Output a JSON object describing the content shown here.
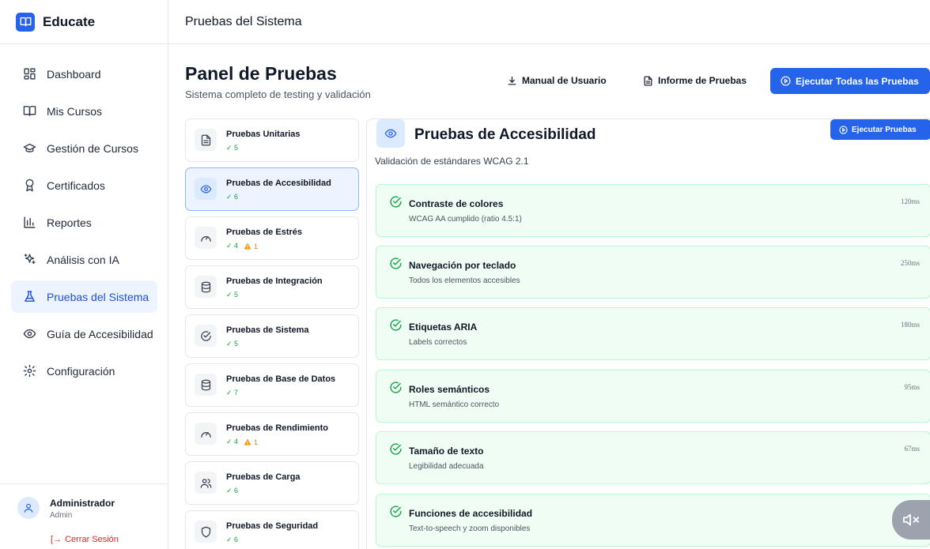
{
  "brand": {
    "name": "Educate"
  },
  "nav": {
    "items": [
      {
        "label": "Dashboard",
        "icon": "dashboard-icon"
      },
      {
        "label": "Mis Cursos",
        "icon": "book-open-icon"
      },
      {
        "label": "Gestión de Cursos",
        "icon": "graduation-cap-icon"
      },
      {
        "label": "Certificados",
        "icon": "award-icon"
      },
      {
        "label": "Reportes",
        "icon": "bar-chart-icon"
      },
      {
        "label": "Análisis con IA",
        "icon": "sparkles-icon"
      },
      {
        "label": "Pruebas del Sistema",
        "icon": "flask-icon",
        "active": true
      },
      {
        "label": "Guía de Accesibilidad",
        "icon": "eye-icon"
      },
      {
        "label": "Configuración",
        "icon": "settings-icon"
      }
    ]
  },
  "user": {
    "name": "Administrador",
    "role": "Admin",
    "logout_label": "Cerrar Sesión"
  },
  "topbar": {
    "title": "Pruebas del Sistema"
  },
  "header": {
    "title": "Panel de Pruebas",
    "subtitle": "Sistema completo de testing y validación",
    "manual_label": "Manual de Usuario",
    "report_label": "Informe de Pruebas",
    "run_all_label": "Ejecutar Todas las Pruebas"
  },
  "test_suites": [
    {
      "name": "Pruebas Unitarias",
      "passed": "✓ 5",
      "warnings": "",
      "icon": "file-text-icon"
    },
    {
      "name": "Pruebas de Accesibilidad",
      "passed": "✓ 6",
      "warnings": "",
      "icon": "eye-icon",
      "active": true
    },
    {
      "name": "Pruebas de Estrés",
      "passed": "✓ 4",
      "warnings": "1",
      "icon": "gauge-icon"
    },
    {
      "name": "Pruebas de Integración",
      "passed": "✓ 5",
      "warnings": "",
      "icon": "database-icon"
    },
    {
      "name": "Pruebas de Sistema",
      "passed": "✓ 5",
      "warnings": "",
      "icon": "check-circle-icon"
    },
    {
      "name": "Pruebas de Base de Datos",
      "passed": "✓ 7",
      "warnings": "",
      "icon": "database-icon"
    },
    {
      "name": "Pruebas de Rendimiento",
      "passed": "✓ 4",
      "warnings": "1",
      "icon": "gauge-icon"
    },
    {
      "name": "Pruebas de Carga",
      "passed": "✓ 6",
      "warnings": "",
      "icon": "users-icon"
    },
    {
      "name": "Pruebas de Seguridad",
      "passed": "✓ 6",
      "warnings": "",
      "icon": "shield-icon"
    }
  ],
  "detail": {
    "title": "Pruebas de Accesibilidad",
    "subtitle": "Validación de estándares WCAG 2.1",
    "run_label": "Ejecutar Pruebas",
    "results": [
      {
        "name": "Contraste de colores",
        "desc": "WCAG AA cumplido (ratio 4.5:1)",
        "time": "120ms"
      },
      {
        "name": "Navegación por teclado",
        "desc": "Todos los elementos accesibles",
        "time": "250ms"
      },
      {
        "name": "Etiquetas ARIA",
        "desc": "Labels correctos",
        "time": "180ms"
      },
      {
        "name": "Roles semánticos",
        "desc": "HTML semántico correcto",
        "time": "95ms"
      },
      {
        "name": "Tamaño de texto",
        "desc": "Legibilidad adecuada",
        "time": "67ms"
      },
      {
        "name": "Funciones de accesibilidad",
        "desc": "Text-to-speech y zoom disponibles",
        "time": ""
      }
    ]
  },
  "colors": {
    "primary": "#2563eb",
    "success_bg": "#f0fdf4",
    "success": "#16a34a",
    "warning": "#d97706",
    "danger": "#dc2626"
  }
}
